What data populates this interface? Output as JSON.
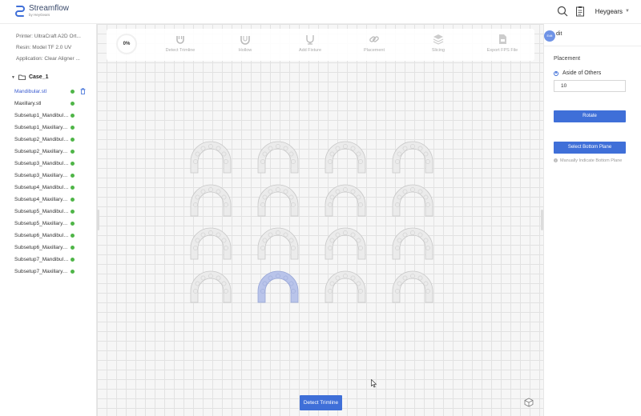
{
  "app": {
    "logo_title": "Streamflow",
    "logo_subtitle": "by HeyGears",
    "user_name": "Heygears",
    "icons": [
      "streamflow-logo-icon",
      "search-icon",
      "clipboard-icon",
      "chevron-down-icon"
    ]
  },
  "info": {
    "printer": "Printer:  UltraCraft A2D Ort...",
    "resin": "Resin:  Model TF 2.0 UV",
    "application": "Application:  Clear Aligner ..."
  },
  "case": {
    "name": "Case_1"
  },
  "files": [
    "Mandibular.stl",
    "Maxillary.stl",
    "Subsetup1_Mandibular...",
    "Subsetup1_Maxillary.stl",
    "Subsetup2_Mandibular...",
    "Subsetup2_Maxillary.stl",
    "Subsetup3_Mandibular...",
    "Subsetup3_Maxillary.stl",
    "Subsetup4_Mandibular...",
    "Subsetup4_Maxillary.stl",
    "Subsetup5_Mandibular...",
    "Subsetup5_Maxillary.stl",
    "Subsetup6_Mandibular...",
    "Subsetup6_Maxillary.stl",
    "Subsetup7_Mandibular...",
    "Subsetup7_Maxillary.stl"
  ],
  "toolbar": {
    "progress": "0%",
    "steps": [
      "Detect Trimline",
      "Hollow",
      "Add Fixture",
      "Placement",
      "Slicing",
      "Export FPS File"
    ]
  },
  "canvas": {
    "detect_button": "Detect Trimline",
    "selected_model_index": 13
  },
  "right": {
    "badge": "Edit",
    "title": "dit",
    "placement_label": "Placement",
    "radio_label": "Aside of Others",
    "distance_value": "10",
    "rotate_button": "Rotate",
    "bottom_plane_button": "Select Bottom Plane",
    "hint": "Manually Indicate Bottom Plane"
  },
  "colors": {
    "accent": "#3f6fd8",
    "ok": "#4fb548",
    "selected_model": "#b9c4ea"
  }
}
